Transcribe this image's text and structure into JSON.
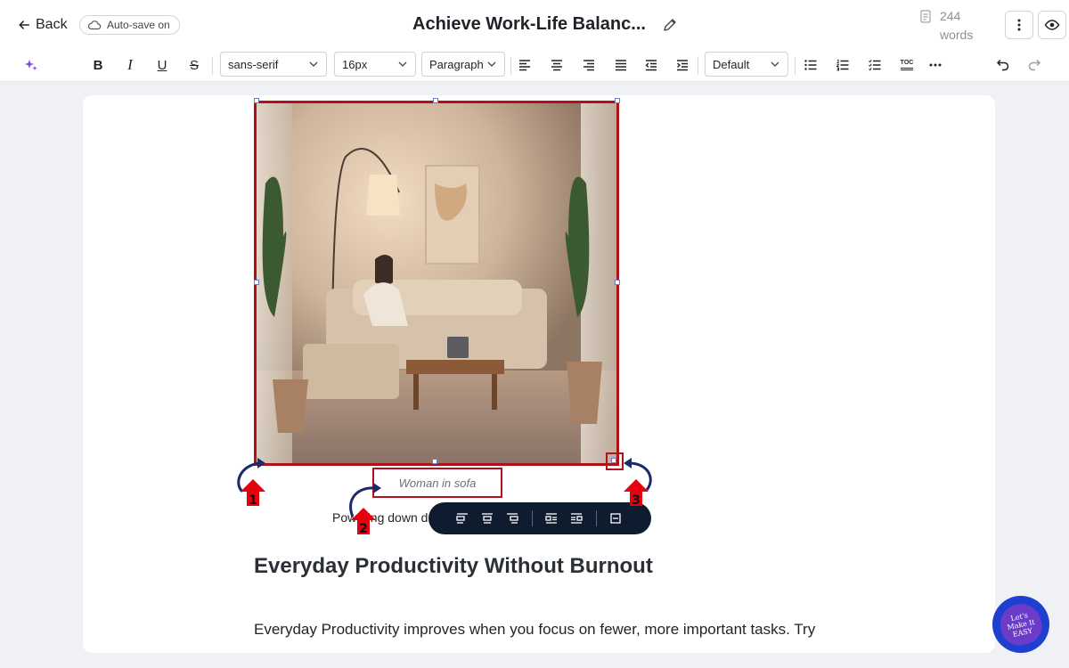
{
  "header": {
    "back_label": "Back",
    "autosave_label": "Auto-save on",
    "title": "Achieve Work-Life Balanc...",
    "word_count": "244",
    "word_label": "words"
  },
  "toolbar": {
    "ai_icon": "sparkle-icon",
    "bold": "B",
    "italic": "I",
    "underline": "U",
    "strike": "S",
    "font_family": "sans-serif",
    "font_size": "16px",
    "block_type": "Paragraph",
    "line_style": "Default",
    "toc": "TOC"
  },
  "editor": {
    "image_caption": "Woman in sofa",
    "paragraph_small": "Powering down d                                                     work has ended.",
    "heading": "Everyday Productivity Without Burnout",
    "body": "Everyday Productivity improves when you focus on fewer, more important tasks. Try choosing your top three priorities each morning. Work in short"
  },
  "annotations": [
    {
      "number": "1",
      "color": "#e8000f"
    },
    {
      "number": "2",
      "color": "#e8000f"
    },
    {
      "number": "3",
      "color": "#e8000f"
    }
  ],
  "badge": {
    "text": "Let's Make It EASY"
  },
  "colors": {
    "accent_red": "#b0121b",
    "annotation_red": "#e8000f",
    "arrow_navy": "#1a2a6c",
    "float_toolbar_bg": "#0f1b2e",
    "badge_blue": "#1e3fd0",
    "badge_purple": "#6a3cc9",
    "sparkle_purple": "#7b4ddb"
  }
}
